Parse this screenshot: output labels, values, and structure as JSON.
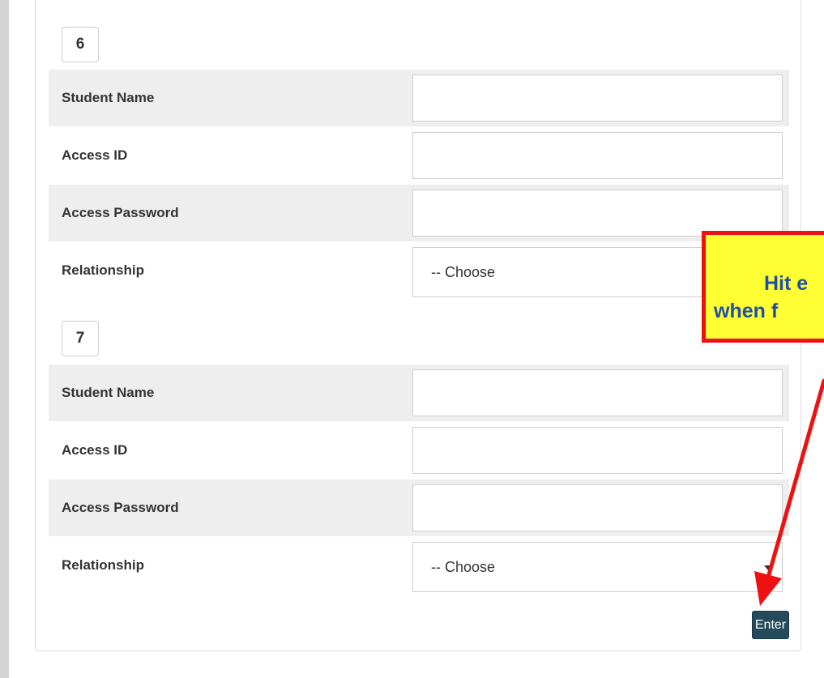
{
  "groups": [
    {
      "number": "6",
      "fields": [
        {
          "label": "Student Name",
          "value": ""
        },
        {
          "label": "Access ID",
          "value": ""
        },
        {
          "label": "Access Password",
          "value": ""
        },
        {
          "label": "Relationship",
          "selected": "-- Choose"
        }
      ]
    },
    {
      "number": "7",
      "fields": [
        {
          "label": "Student Name",
          "value": ""
        },
        {
          "label": "Access ID",
          "value": ""
        },
        {
          "label": "Access Password",
          "value": ""
        },
        {
          "label": "Relationship",
          "selected": "-- Choose"
        }
      ]
    }
  ],
  "submit": {
    "label": "Enter"
  },
  "callout": {
    "line1": "Hit e",
    "line2": "when f"
  },
  "colors": {
    "callout_background": "#ffff33",
    "callout_border": "#ee1111",
    "callout_text": "#1f4fa8",
    "arrow": "#ee1111",
    "button": "#244a5c"
  }
}
